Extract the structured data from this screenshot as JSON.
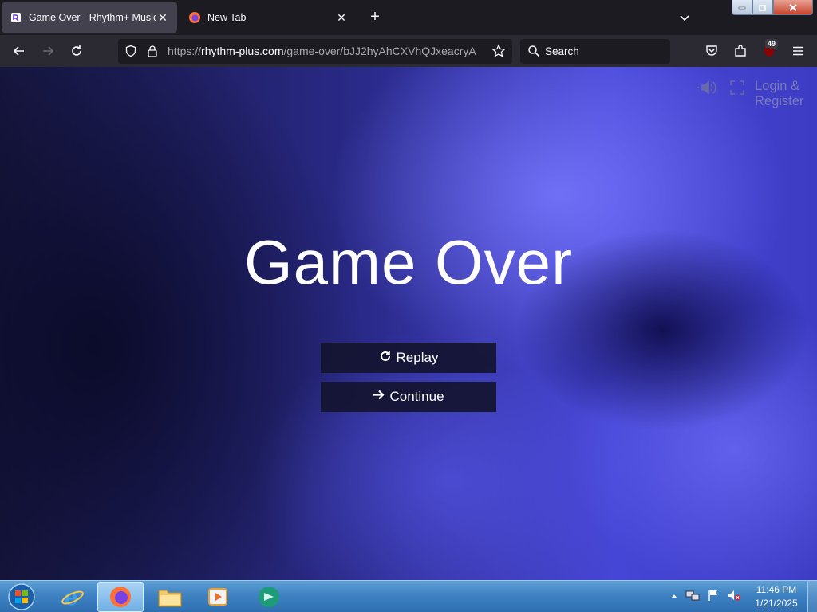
{
  "browser": {
    "tabs": [
      {
        "title": "Game Over - Rhythm+ Music Game",
        "active": true
      },
      {
        "title": "New Tab",
        "active": false
      }
    ],
    "url": {
      "prefix": "https://",
      "host": "rhythm-plus.com",
      "path": "/game-over/bJJ2hyAhCXVhQJxeacryA"
    },
    "search_placeholder": "Search",
    "extension_badge": "49"
  },
  "page": {
    "auth_link": {
      "line1": "Login &",
      "line2": "Register"
    },
    "title": "Game Over",
    "buttons": {
      "replay": "Replay",
      "continue": "Continue"
    }
  },
  "taskbar": {
    "time": "11:46 PM",
    "date": "1/21/2025"
  }
}
